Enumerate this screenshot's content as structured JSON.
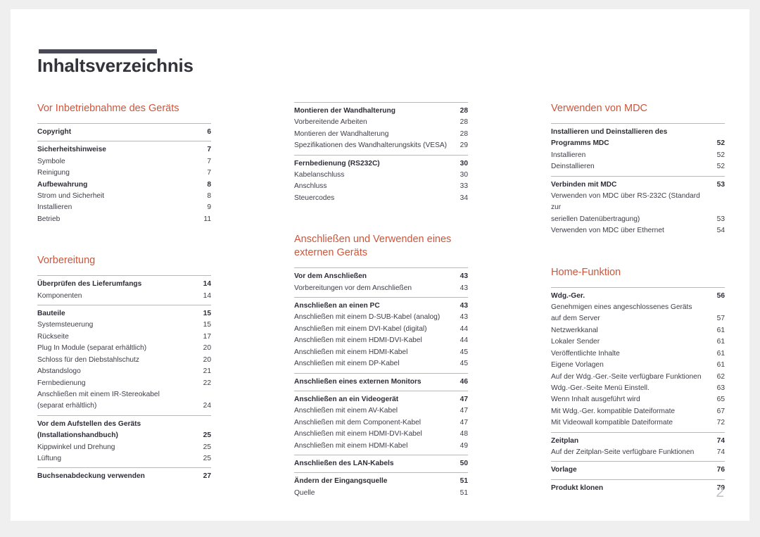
{
  "document": {
    "title": "Inhaltsverzeichnis",
    "page_number": "2",
    "accent_color": "#cb563c",
    "rule_color": "#4a4a57"
  },
  "columns": [
    {
      "id": "column-1",
      "sections": [
        {
          "heading": "Vor Inbetriebnahme des Geräts",
          "groups": [
            {
              "entries": [
                {
                  "label": "Copyright",
                  "page": "6",
                  "bold": true
                }
              ]
            },
            {
              "entries": [
                {
                  "label": "Sicherheitshinweise",
                  "page": "7",
                  "bold": true
                },
                {
                  "label": "Symbole",
                  "page": "7",
                  "bold": false
                },
                {
                  "label": "Reinigung",
                  "page": "7",
                  "bold": false
                },
                {
                  "label": "Aufbewahrung",
                  "page": "8",
                  "bold": true
                },
                {
                  "label": "Strom und Sicherheit",
                  "page": "8",
                  "bold": false
                },
                {
                  "label": "Installieren",
                  "page": "9",
                  "bold": false
                },
                {
                  "label": "Betrieb",
                  "page": "11",
                  "bold": false
                }
              ]
            }
          ]
        },
        {
          "heading": "Vorbereitung",
          "groups": [
            {
              "entries": [
                {
                  "label": "Überprüfen des Lieferumfangs",
                  "page": "14",
                  "bold": true
                },
                {
                  "label": "Komponenten",
                  "page": "14",
                  "bold": false
                }
              ]
            },
            {
              "entries": [
                {
                  "label": "Bauteile",
                  "page": "15",
                  "bold": true
                },
                {
                  "label": "Systemsteuerung",
                  "page": "15",
                  "bold": false
                },
                {
                  "label": "Rückseite",
                  "page": "17",
                  "bold": false
                },
                {
                  "label": "Plug In Module (separat erhältlich)",
                  "page": "20",
                  "bold": false
                },
                {
                  "label": "Schloss für den Diebstahlschutz",
                  "page": "20",
                  "bold": false
                },
                {
                  "label": "Abstandslogo",
                  "page": "21",
                  "bold": false
                },
                {
                  "label": "Fernbedienung",
                  "page": "22",
                  "bold": false
                },
                {
                  "label": "Anschließen mit einem IR-Stereokabel\n(separat erhältlich)",
                  "page": "24",
                  "bold": false,
                  "num_bottom": true
                }
              ]
            },
            {
              "entries": [
                {
                  "label": "Vor dem Aufstellen des Geräts\n(Installationshandbuch)",
                  "page": "25",
                  "bold": true,
                  "num_bottom": true
                },
                {
                  "label": "Kippwinkel und Drehung",
                  "page": "25",
                  "bold": false
                },
                {
                  "label": "Lüftung",
                  "page": "25",
                  "bold": false
                }
              ]
            },
            {
              "entries": [
                {
                  "label": "Buchsenabdeckung verwenden",
                  "page": "27",
                  "bold": true
                }
              ]
            }
          ]
        }
      ]
    },
    {
      "id": "column-2",
      "sections": [
        {
          "heading": "",
          "groups": [
            {
              "entries": [
                {
                  "label": "Montieren der Wandhalterung",
                  "page": "28",
                  "bold": true
                },
                {
                  "label": "Vorbereitende Arbeiten",
                  "page": "28",
                  "bold": false
                },
                {
                  "label": "Montieren der Wandhalterung",
                  "page": "28",
                  "bold": false
                },
                {
                  "label": "Spezifikationen des Wandhalterungskits (VESA)",
                  "page": "29",
                  "bold": false
                }
              ]
            },
            {
              "entries": [
                {
                  "label": "Fernbedienung (RS232C)",
                  "page": "30",
                  "bold": true
                },
                {
                  "label": "Kabelanschluss",
                  "page": "30",
                  "bold": false
                },
                {
                  "label": "Anschluss",
                  "page": "33",
                  "bold": false
                },
                {
                  "label": "Steuercodes",
                  "page": "34",
                  "bold": false
                }
              ]
            }
          ]
        },
        {
          "heading": "Anschließen und Verwenden eines externen Geräts",
          "groups": [
            {
              "entries": [
                {
                  "label": "Vor dem Anschließen",
                  "page": "43",
                  "bold": true
                },
                {
                  "label": "Vorbereitungen vor dem Anschließen",
                  "page": "43",
                  "bold": false
                }
              ]
            },
            {
              "entries": [
                {
                  "label": "Anschließen an einen PC",
                  "page": "43",
                  "bold": true
                },
                {
                  "label": "Anschließen mit einem D-SUB-Kabel (analog)",
                  "page": "43",
                  "bold": false
                },
                {
                  "label": "Anschließen mit einem DVI-Kabel (digital)",
                  "page": "44",
                  "bold": false
                },
                {
                  "label": "Anschließen mit einem HDMI-DVI-Kabel",
                  "page": "44",
                  "bold": false
                },
                {
                  "label": "Anschließen mit einem HDMI-Kabel",
                  "page": "45",
                  "bold": false
                },
                {
                  "label": "Anschließen mit einem DP-Kabel",
                  "page": "45",
                  "bold": false
                }
              ]
            },
            {
              "entries": [
                {
                  "label": "Anschließen eines externen Monitors",
                  "page": "46",
                  "bold": true
                }
              ]
            },
            {
              "entries": [
                {
                  "label": "Anschließen an ein Videogerät",
                  "page": "47",
                  "bold": true
                },
                {
                  "label": "Anschließen mit einem AV-Kabel",
                  "page": "47",
                  "bold": false
                },
                {
                  "label": "Anschließen mit dem Component-Kabel",
                  "page": "47",
                  "bold": false
                },
                {
                  "label": "Anschließen mit einem HDMI-DVI-Kabel",
                  "page": "48",
                  "bold": false
                },
                {
                  "label": "Anschließen mit einem HDMI-Kabel",
                  "page": "49",
                  "bold": false
                }
              ]
            },
            {
              "entries": [
                {
                  "label": "Anschließen des LAN-Kabels",
                  "page": "50",
                  "bold": true
                }
              ]
            },
            {
              "entries": [
                {
                  "label": "Ändern der Eingangsquelle",
                  "page": "51",
                  "bold": true
                },
                {
                  "label": "Quelle",
                  "page": "51",
                  "bold": false
                }
              ]
            }
          ]
        }
      ]
    },
    {
      "id": "column-3",
      "sections": [
        {
          "heading": "Verwenden von MDC",
          "groups": [
            {
              "entries": [
                {
                  "label": "Installieren und Deinstallieren des\nProgramms MDC",
                  "page": "52",
                  "bold": true,
                  "num_bottom": true
                },
                {
                  "label": "Installieren",
                  "page": "52",
                  "bold": false
                },
                {
                  "label": "Deinstallieren",
                  "page": "52",
                  "bold": false
                }
              ]
            },
            {
              "entries": [
                {
                  "label": "Verbinden mit MDC",
                  "page": "53",
                  "bold": true
                },
                {
                  "label": "Verwenden von MDC über RS-232C (Standard zur\nseriellen Datenübertragung)",
                  "page": "53",
                  "bold": false,
                  "num_bottom": true
                },
                {
                  "label": "Verwenden von MDC über Ethernet",
                  "page": "54",
                  "bold": false
                }
              ]
            }
          ]
        },
        {
          "heading": "Home-Funktion",
          "groups": [
            {
              "entries": [
                {
                  "label": "Wdg.-Ger.",
                  "page": "56",
                  "bold": true
                },
                {
                  "label": "Genehmigen eines angeschlossenes Geräts\nauf dem Server",
                  "page": "57",
                  "bold": false,
                  "num_bottom": true
                },
                {
                  "label": "Netzwerkkanal",
                  "page": "61",
                  "bold": false
                },
                {
                  "label": "Lokaler Sender",
                  "page": "61",
                  "bold": false
                },
                {
                  "label": "Veröffentlichte Inhalte",
                  "page": "61",
                  "bold": false
                },
                {
                  "label": "Eigene Vorlagen",
                  "page": "61",
                  "bold": false
                },
                {
                  "label": "Auf der Wdg.-Ger.-Seite verfügbare Funktionen",
                  "page": "62",
                  "bold": false
                },
                {
                  "label": "Wdg.-Ger.-Seite Menü Einstell.",
                  "page": "63",
                  "bold": false
                },
                {
                  "label": "Wenn Inhalt ausgeführt wird",
                  "page": "65",
                  "bold": false
                },
                {
                  "label": "Mit Wdg.-Ger. kompatible Dateiformate",
                  "page": "67",
                  "bold": false
                },
                {
                  "label": "Mit Videowall kompatible Dateiformate",
                  "page": "72",
                  "bold": false
                }
              ]
            },
            {
              "entries": [
                {
                  "label": "Zeitplan",
                  "page": "74",
                  "bold": true
                },
                {
                  "label": "Auf der Zeitplan-Seite verfügbare Funktionen",
                  "page": "74",
                  "bold": false
                }
              ]
            },
            {
              "entries": [
                {
                  "label": "Vorlage",
                  "page": "76",
                  "bold": true
                }
              ]
            },
            {
              "entries": [
                {
                  "label": "Produkt klonen",
                  "page": "79",
                  "bold": true
                }
              ]
            }
          ]
        }
      ]
    }
  ]
}
